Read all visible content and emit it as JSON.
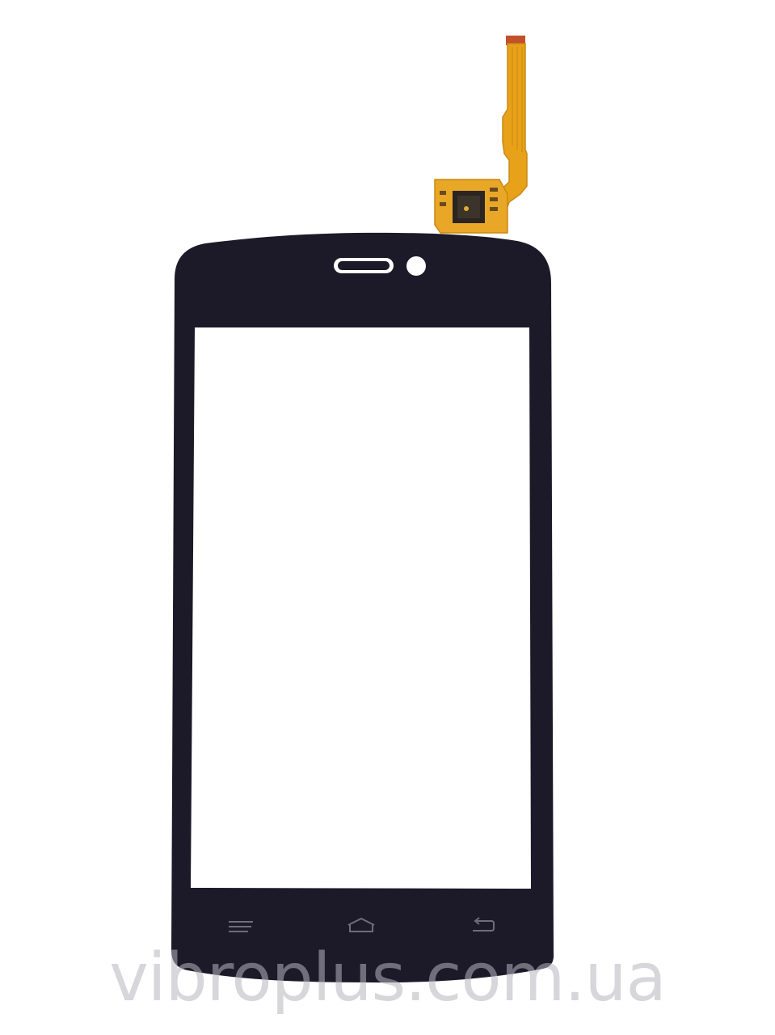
{
  "watermark": {
    "text": "vibroplus.com.ua"
  },
  "colors": {
    "background": "#ffffff",
    "panel_frame": "#1c1a28",
    "display_area": "#ffffff",
    "flex_cable": "#e7a21a",
    "chip": "#2a2520",
    "nav_keys": "#6f6d7a",
    "watermark": "#b4b4be"
  },
  "icons": {
    "menu_key": "menu-icon",
    "home_key": "home-icon",
    "back_key": "back-icon"
  }
}
